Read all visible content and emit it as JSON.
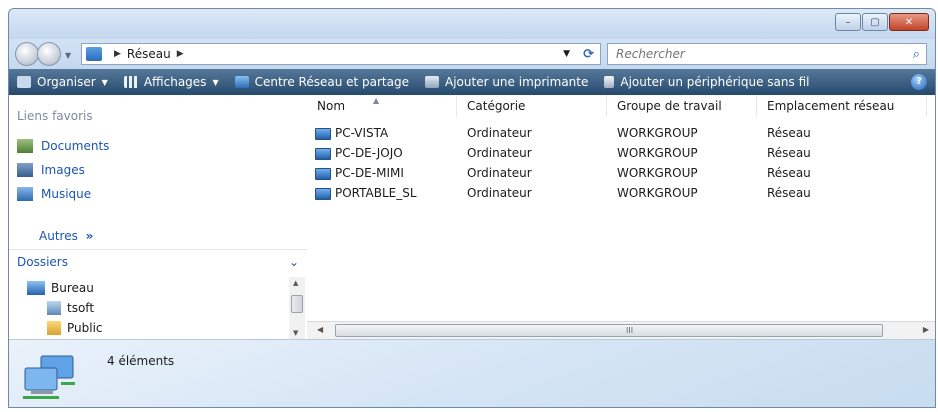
{
  "window": {
    "controls": {
      "minimize": "–",
      "maximize": "▢",
      "close": "✕"
    }
  },
  "address": {
    "location": "Réseau",
    "search_placeholder": "Rechercher"
  },
  "toolbar": {
    "organize": "Organiser",
    "views": "Affichages",
    "network_center": "Centre Réseau et partage",
    "add_printer": "Ajouter une imprimante",
    "add_wireless": "Ajouter un périphérique sans fil"
  },
  "nav": {
    "favorites_header": "Liens favoris",
    "favorites": [
      {
        "label": "Documents",
        "icon": "documents-icon"
      },
      {
        "label": "Images",
        "icon": "images-icon"
      },
      {
        "label": "Musique",
        "icon": "music-icon"
      }
    ],
    "more": "Autres",
    "folders_header": "Dossiers",
    "tree": [
      {
        "label": "Bureau",
        "icon": "desktop-icon"
      },
      {
        "label": "tsoft",
        "icon": "user-icon"
      },
      {
        "label": "Public",
        "icon": "folder-icon"
      }
    ]
  },
  "list": {
    "columns": [
      "Nom",
      "Catégorie",
      "Groupe de travail",
      "Emplacement réseau"
    ],
    "rows": [
      [
        "PC-VISTA",
        "Ordinateur",
        "WORKGROUP",
        "Réseau"
      ],
      [
        "PC-DE-JOJO",
        "Ordinateur",
        "WORKGROUP",
        "Réseau"
      ],
      [
        "PC-DE-MIMI",
        "Ordinateur",
        "WORKGROUP",
        "Réseau"
      ],
      [
        "PORTABLE_SL",
        "Ordinateur",
        "WORKGROUP",
        "Réseau"
      ]
    ],
    "scroll_grip": "III"
  },
  "details": {
    "count": "4 éléments"
  }
}
